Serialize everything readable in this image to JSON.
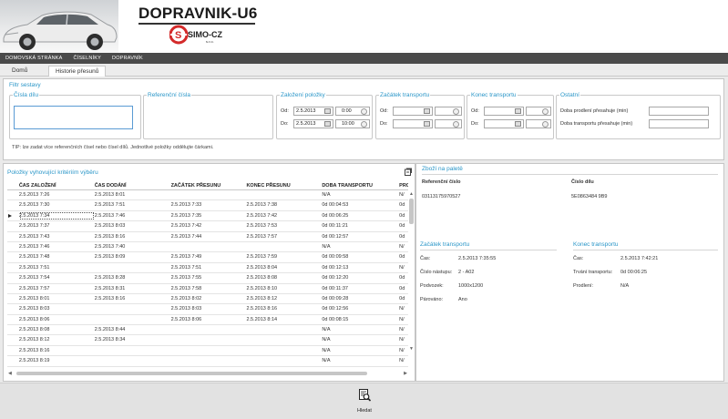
{
  "header": {
    "title": "DOPRAVNIK-U6",
    "logo_text": "SIMO-CZ",
    "logo_sub": "s.r.o."
  },
  "topnav": [
    {
      "label": "DOMOVSKÁ STRÁNKA"
    },
    {
      "label": "ČÍSELNÍKY"
    },
    {
      "label": "DOPRAVNÍK"
    }
  ],
  "tabs": {
    "home": "Domů",
    "history": "Historie přesunů"
  },
  "filter": {
    "title": "Filtr sestavy",
    "parts_label": "Čísla dílu",
    "refs_label": "Referenční čísla",
    "created": {
      "label": "Založení položky",
      "from_label": "Od:",
      "from_date": "2.5.2013",
      "from_time": "0:00",
      "to_label": "Do:",
      "to_date": "2.5.2013",
      "to_time": "10:00"
    },
    "start": {
      "label": "Začátek transportu",
      "from_label": "Od:",
      "to_label": "Do:"
    },
    "end": {
      "label": "Konec transportu",
      "from_label": "Od:",
      "to_label": "Do:"
    },
    "other": {
      "label": "Ostatní",
      "delay_label": "Doba prodlení přesahuje (min)",
      "transport_label": "Doba transportu přesahuje (min)"
    },
    "tip": "TIP: lze zadat více referenčních čísel nebo čísel dílů. Jednotlivé položky oddělujte čárkami."
  },
  "results": {
    "title": "Položky vyhovující kritériím výběru",
    "columns": [
      "ČAS ZALOŽENÍ",
      "ČAS DODÁNÍ",
      "ZAČÁTEK PŘESUNU",
      "KONEC PŘESUNU",
      "DOBA TRANSPORTU",
      "PRODL"
    ],
    "rows": [
      [
        "2.5.2013 7:26",
        "2.5.2013 8:01",
        "",
        "",
        "N/A",
        "N/"
      ],
      [
        "2.5.2013 7:30",
        "2.5.2013 7:51",
        "2.5.2013 7:33",
        "2.5.2013 7:38",
        "0d 00:04:53",
        "0d"
      ],
      [
        "2.5.2013 7:34",
        "2.5.2013 7:46",
        "2.5.2013 7:35",
        "2.5.2013 7:42",
        "0d 00:06:25",
        "0d"
      ],
      [
        "2.5.2013 7:37",
        "2.5.2013 8:03",
        "2.5.2013 7:42",
        "2.5.2013 7:53",
        "0d 00:11:21",
        "0d"
      ],
      [
        "2.5.2013 7:43",
        "2.5.2013 8:16",
        "2.5.2013 7:44",
        "2.5.2013 7:57",
        "0d 00:12:57",
        "0d"
      ],
      [
        "2.5.2013 7:46",
        "2.5.2013 7:40",
        "",
        "",
        "N/A",
        "N/"
      ],
      [
        "2.5.2013 7:48",
        "2.5.2013 8:09",
        "2.5.2013 7:49",
        "2.5.2013 7:59",
        "0d 00:09:58",
        "0d"
      ],
      [
        "2.5.2013 7:51",
        "",
        "2.5.2013 7:51",
        "2.5.2013 8:04",
        "0d 00:12:13",
        "N/"
      ],
      [
        "2.5.2013 7:54",
        "2.5.2013 8:28",
        "2.5.2013 7:55",
        "2.5.2013 8:08",
        "0d 00:12:20",
        "0d"
      ],
      [
        "2.5.2013 7:57",
        "2.5.2013 8:31",
        "2.5.2013 7:58",
        "2.5.2013 8:10",
        "0d 00:11:37",
        "0d"
      ],
      [
        "2.5.2013 8:01",
        "2.5.2013 8:16",
        "2.5.2013 8:02",
        "2.5.2013 8:12",
        "0d 00:09:28",
        "0d"
      ],
      [
        "2.5.2013 8:03",
        "",
        "2.5.2013 8:03",
        "2.5.2013 8:16",
        "0d 00:12:56",
        "N/"
      ],
      [
        "2.5.2013 8:06",
        "",
        "2.5.2013 8:06",
        "2.5.2013 8:14",
        "0d 00:08:15",
        "N/"
      ],
      [
        "2.5.2013 8:08",
        "2.5.2013 8:44",
        "",
        "",
        "N/A",
        "N/"
      ],
      [
        "2.5.2013 8:12",
        "2.5.2013 8:34",
        "",
        "",
        "N/A",
        "N/"
      ],
      [
        "2.5.2013 8:16",
        "",
        "",
        "",
        "N/A",
        "N/"
      ],
      [
        "2.5.2013 8:19",
        "",
        "",
        "",
        "N/A",
        "N/"
      ]
    ],
    "selected_row": 2
  },
  "detail": {
    "goods_title": "Zboží na paletě",
    "ref_header": "Referenční číslo",
    "part_header": "Číslo dílu",
    "ref_value": "03113175970527",
    "part_value": "5E0863484  9B9",
    "start": {
      "title": "Začátek transportu",
      "time_label": "Čas:",
      "time_value": "2.5.2013 7:35:55",
      "entry_label": "Číslo nástupu:",
      "entry_value": "2 - A02",
      "pad_label": "Podvozek:",
      "pad_value": "1000x1200",
      "pair_label": "Párováno:",
      "pair_value": "Ano"
    },
    "end": {
      "title": "Konec transportu",
      "time_label": "Čas:",
      "time_value": "2.5.2013 7:42:21",
      "duration_label": "Trvání transportu:",
      "duration_value": "0d 00:06:25",
      "delay_label": "Prodlení:",
      "delay_value": "N/A"
    }
  },
  "footer": {
    "search_label": "Hledat"
  },
  "colors": {
    "accent": "#2a96c8",
    "nav_bg": "#4a4a4a",
    "logo_red": "#d42a2a"
  }
}
